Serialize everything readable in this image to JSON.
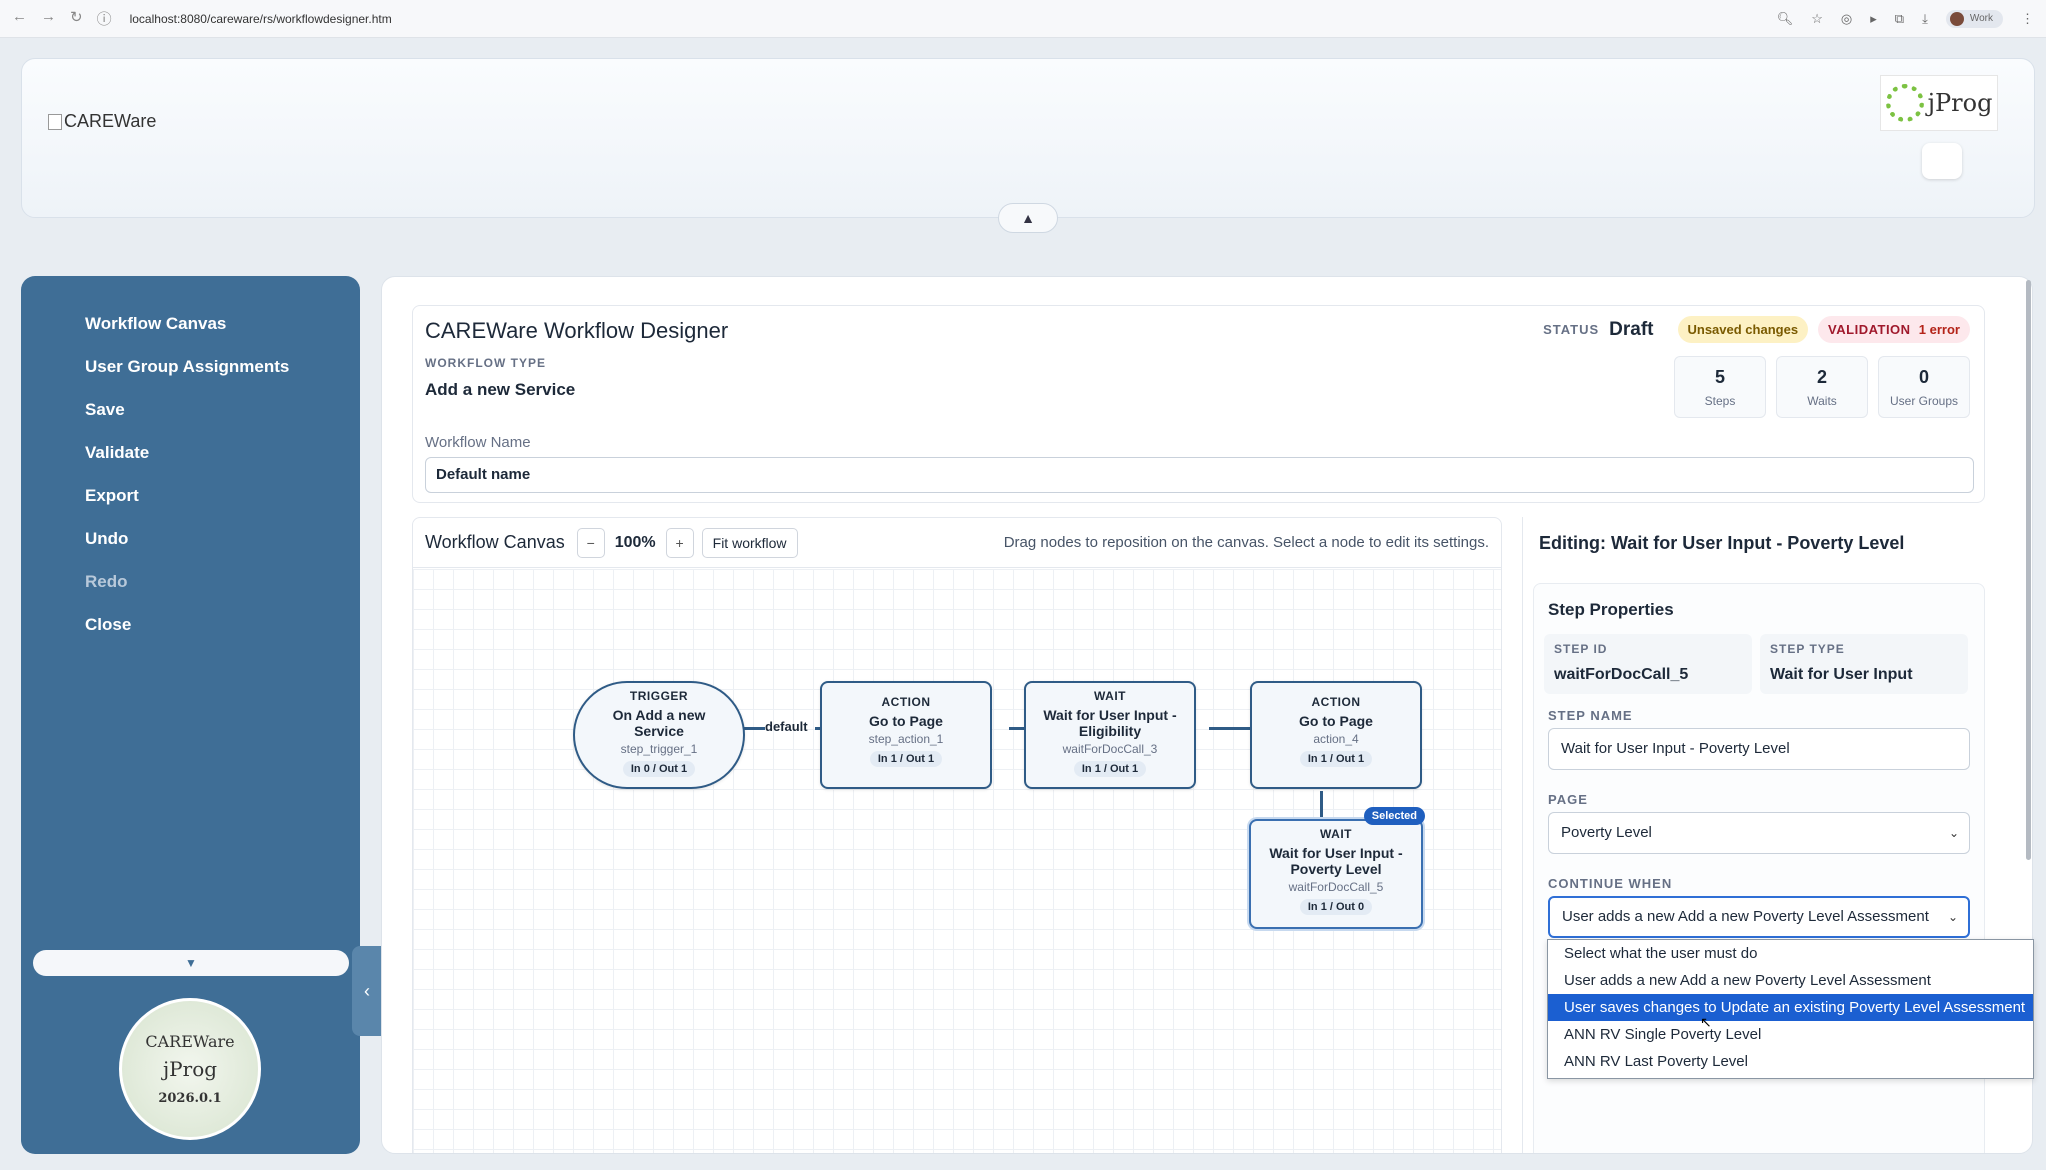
{
  "browser": {
    "url": "localhost:8080/careware/rs/workflowdesigner.htm",
    "profile": "Work"
  },
  "header": {
    "logo_alt": "CAREWare",
    "jprog_logo": "jProg",
    "collapse_icon": "▲"
  },
  "sidebar": {
    "items": [
      {
        "label": "Workflow Canvas",
        "enabled": true
      },
      {
        "label": "User Group Assignments",
        "enabled": true
      },
      {
        "label": "Save",
        "enabled": true
      },
      {
        "label": "Validate",
        "enabled": true
      },
      {
        "label": "Export",
        "enabled": true
      },
      {
        "label": "Undo",
        "enabled": true
      },
      {
        "label": "Redo",
        "enabled": false
      },
      {
        "label": "Close",
        "enabled": true
      }
    ],
    "toggle_icon": "‹",
    "scroll_icon": "▼",
    "seal": {
      "top": "CAREWare",
      "brand": "jProg",
      "version": "2026.0.1"
    }
  },
  "main": {
    "title": "CAREWare Workflow Designer",
    "workflow_type_label": "WORKFLOW TYPE",
    "workflow_type": "Add a new Service",
    "workflow_name_label": "Workflow Name",
    "workflow_name": "Default name",
    "status_label": "STATUS",
    "status": "Draft",
    "unsaved_badge": "Unsaved changes",
    "validation_label": "VALIDATION",
    "validation_value": "1 error",
    "stats": [
      {
        "num": "5",
        "label": "Steps"
      },
      {
        "num": "2",
        "label": "Waits"
      },
      {
        "num": "0",
        "label": "User Groups"
      }
    ]
  },
  "canvas": {
    "title": "Workflow Canvas",
    "zoom_out": "−",
    "zoom": "100%",
    "zoom_in": "+",
    "fit": "Fit workflow",
    "hint": "Drag nodes to reposition on the canvas. Select a node to edit its settings.",
    "edge_label": "default",
    "nodes": [
      {
        "kind": "TRIGGER",
        "title": "On Add a new Service",
        "id": "step_trigger_1",
        "io": "In 0 / Out 1"
      },
      {
        "kind": "ACTION",
        "title": "Go to Page",
        "id": "step_action_1",
        "io": "In 1 / Out 1"
      },
      {
        "kind": "WAIT",
        "title": "Wait for User Input - Eligibility",
        "id": "waitForDocCall_3",
        "io": "In 1 / Out 1"
      },
      {
        "kind": "ACTION",
        "title": "Go to Page",
        "id": "action_4",
        "io": "In 1 / Out 1"
      },
      {
        "kind": "WAIT",
        "title": "Wait for User Input - Poverty Level",
        "id": "waitForDocCall_5",
        "io": "In 1 / Out 0",
        "badge": "Selected"
      }
    ]
  },
  "editor": {
    "title": "Editing: Wait for User Input - Poverty Level",
    "section": "Step Properties",
    "step_id_label": "STEP ID",
    "step_id": "waitForDocCall_5",
    "step_type_label": "STEP TYPE",
    "step_type": "Wait for User Input",
    "step_name_label": "STEP NAME",
    "step_name": "Wait for User Input - Poverty Level",
    "page_label": "PAGE",
    "page": "Poverty Level",
    "continue_label": "CONTINUE WHEN",
    "continue_value": "User adds a new Add a new Poverty Level Assessment",
    "options": [
      "Select what the user must do",
      "User adds a new Add a new Poverty Level Assessment",
      "User saves changes to Update an existing Poverty Level Assessment",
      "ANN RV Single Poverty Level",
      "ANN RV Last Poverty Level"
    ]
  }
}
